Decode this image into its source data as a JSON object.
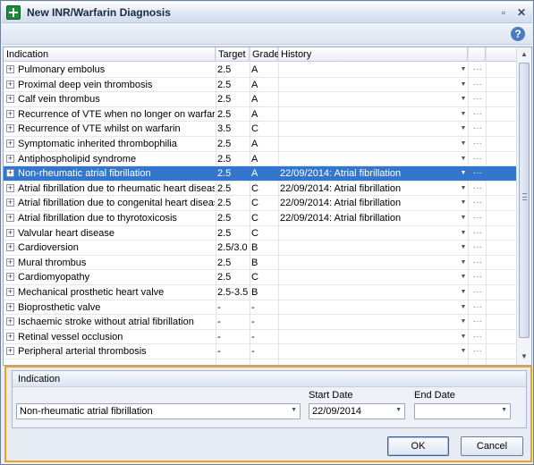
{
  "window": {
    "title": "New INR/Warfarin Diagnosis",
    "controls": {
      "minimize": "▫",
      "close": "✕"
    }
  },
  "help": {
    "glyph": "?"
  },
  "grid": {
    "columns": [
      "Indication",
      "Target",
      "Grade",
      "History"
    ],
    "rows": [
      {
        "expander": "+",
        "indication": "Pulmonary embolus",
        "target": "2.5",
        "grade": "A",
        "history": "",
        "dropdown": "▼",
        "more": "···"
      },
      {
        "expander": "+",
        "indication": "Proximal deep vein thrombosis",
        "target": "2.5",
        "grade": "A",
        "history": "",
        "dropdown": "▼",
        "more": "···"
      },
      {
        "expander": "+",
        "indication": "Calf vein thrombus",
        "target": "2.5",
        "grade": "A",
        "history": "",
        "dropdown": "▼",
        "more": "···"
      },
      {
        "expander": "+",
        "indication": "Recurrence of VTE when no longer on warfarin",
        "target": "2.5",
        "grade": "A",
        "history": "",
        "dropdown": "▼",
        "more": "···"
      },
      {
        "expander": "+",
        "indication": "Recurrence of VTE whilst on warfarin",
        "target": "3.5",
        "grade": "C",
        "history": "",
        "dropdown": "▼",
        "more": "···"
      },
      {
        "expander": "+",
        "indication": "Symptomatic inherited thrombophilia",
        "target": "2.5",
        "grade": "A",
        "history": "",
        "dropdown": "▼",
        "more": "···"
      },
      {
        "expander": "+",
        "indication": "Antiphospholipid syndrome",
        "target": "2.5",
        "grade": "A",
        "history": "",
        "dropdown": "▼",
        "more": "···"
      },
      {
        "expander": "+",
        "indication": "Non-rheumatic atrial fibrillation",
        "target": "2.5",
        "grade": "A",
        "history": "22/09/2014: Atrial fibrillation",
        "dropdown": "▼",
        "more": "···",
        "selected": true
      },
      {
        "expander": "+",
        "indication": "Atrial fibrillation due to rheumatic heart disease",
        "target": "2.5",
        "grade": "C",
        "history": "22/09/2014: Atrial fibrillation",
        "dropdown": "▼",
        "more": "···"
      },
      {
        "expander": "+",
        "indication": "Atrial fibrillation due to congenital heart disease",
        "target": "2.5",
        "grade": "C",
        "history": "22/09/2014: Atrial fibrillation",
        "dropdown": "▼",
        "more": "···"
      },
      {
        "expander": "+",
        "indication": "Atrial fibrillation due to thyrotoxicosis",
        "target": "2.5",
        "grade": "C",
        "history": "22/09/2014: Atrial fibrillation",
        "dropdown": "▼",
        "more": "···"
      },
      {
        "expander": "+",
        "indication": "Valvular heart disease",
        "target": "2.5",
        "grade": "C",
        "history": "",
        "dropdown": "▼",
        "more": "···"
      },
      {
        "expander": "+",
        "indication": "Cardioversion",
        "target": "2.5/3.0",
        "grade": "B",
        "history": "",
        "dropdown": "▼",
        "more": "···"
      },
      {
        "expander": "+",
        "indication": "Mural thrombus",
        "target": "2.5",
        "grade": "B",
        "history": "",
        "dropdown": "▼",
        "more": "···"
      },
      {
        "expander": "+",
        "indication": "Cardiomyopathy",
        "target": "2.5",
        "grade": "C",
        "history": "",
        "dropdown": "▼",
        "more": "···"
      },
      {
        "expander": "+",
        "indication": "Mechanical prosthetic heart valve",
        "target": "2.5-3.5",
        "grade": "B",
        "history": "",
        "dropdown": "▼",
        "more": "···"
      },
      {
        "expander": "+",
        "indication": "Bioprosthetic valve",
        "target": "-",
        "grade": "-",
        "history": "",
        "dropdown": "▼",
        "more": "···"
      },
      {
        "expander": "+",
        "indication": "Ischaemic stroke without atrial fibrillation",
        "target": "-",
        "grade": "-",
        "history": "",
        "dropdown": "▼",
        "more": "···"
      },
      {
        "expander": "+",
        "indication": "Retinal vessel occlusion",
        "target": "-",
        "grade": "-",
        "history": "",
        "dropdown": "▼",
        "more": "···"
      },
      {
        "expander": "+",
        "indication": "Peripheral arterial thrombosis",
        "target": "-",
        "grade": "-",
        "history": "",
        "dropdown": "▼",
        "more": "···"
      }
    ],
    "scroll": {
      "up": "▲",
      "down": "▼"
    }
  },
  "details": {
    "group_title": "Indication",
    "indication_value": "Non-rheumatic atrial fibrillation",
    "start_date_label": "Start Date",
    "start_date_value": "22/09/2014",
    "end_date_label": "End Date",
    "end_date_value": "",
    "arrow": "▼"
  },
  "buttons": {
    "ok": "OK",
    "cancel": "Cancel"
  }
}
